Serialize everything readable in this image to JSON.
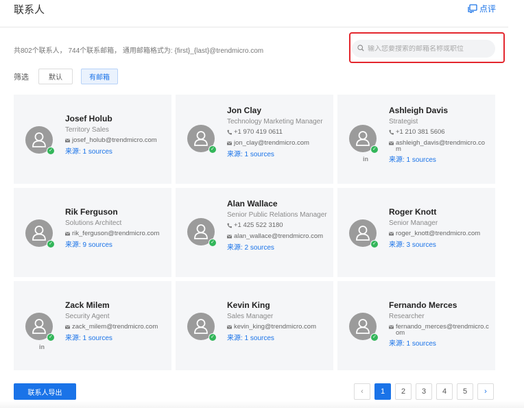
{
  "header": {
    "title": "联系人",
    "review_label": "点评",
    "review_icon": "chat-bubble-icon"
  },
  "summary_text": "共802个联系人， 744个联系邮箱， 通用邮箱格式为: {first}_{last}@trendmicro.com",
  "search": {
    "placeholder": "输入您要搜索的邮箱名称或职位",
    "value": ""
  },
  "filter": {
    "label": "筛选",
    "options": [
      "默认",
      "有邮箱"
    ],
    "active": "有邮箱"
  },
  "contacts": [
    {
      "name": "Josef Holub",
      "title": "Territory Sales",
      "phone": "",
      "email": "josef_holub@trendmicro.com",
      "sources": "来源: 1 sources",
      "linkedin": false
    },
    {
      "name": "Jon Clay",
      "title": "Technology Marketing Manager",
      "phone": "+1 970 419 0611",
      "email": "jon_clay@trendmicro.com",
      "sources": "来源: 1 sources",
      "linkedin": false
    },
    {
      "name": "Ashleigh Davis",
      "title": "Strategist",
      "phone": "+1 210 381 5606",
      "email": "ashleigh_davis@trendmicro.com",
      "sources": "来源: 1 sources",
      "linkedin": true
    },
    {
      "name": "Rik Ferguson",
      "title": "Solutions Architect",
      "phone": "",
      "email": "rik_ferguson@trendmicro.com",
      "sources": "来源: 9 sources",
      "linkedin": false
    },
    {
      "name": "Alan Wallace",
      "title": "Senior Public Relations Manager",
      "phone": "+1 425 522 3180",
      "email": "alan_wallace@trendmicro.com",
      "sources": "来源: 2 sources",
      "linkedin": false
    },
    {
      "name": "Roger Knott",
      "title": "Senior Manager",
      "phone": "",
      "email": "roger_knott@trendmicro.com",
      "sources": "来源: 3 sources",
      "linkedin": false
    },
    {
      "name": "Zack Milem",
      "title": "Security Agent",
      "phone": "",
      "email": "zack_milem@trendmicro.com",
      "sources": "来源: 1 sources",
      "linkedin": true
    },
    {
      "name": "Kevin King",
      "title": "Sales Manager",
      "phone": "",
      "email": "kevin_king@trendmicro.com",
      "sources": "来源: 1 sources",
      "linkedin": false
    },
    {
      "name": "Fernando Merces",
      "title": "Researcher",
      "phone": "",
      "email": "fernando_merces@trendmicro.com",
      "sources": "来源: 1 sources",
      "linkedin": false
    }
  ],
  "linkedin_label": "in",
  "verified_mark": "✓",
  "export_label": "联系人导出",
  "pagination": {
    "prev": "‹",
    "next": "›",
    "pages": [
      "1",
      "2",
      "3",
      "4",
      "5"
    ],
    "current": "1"
  },
  "colors": {
    "accent": "#1a73e8",
    "highlight_border": "#e3262d",
    "verified": "#33b65a",
    "card_bg": "#f5f6f8"
  }
}
